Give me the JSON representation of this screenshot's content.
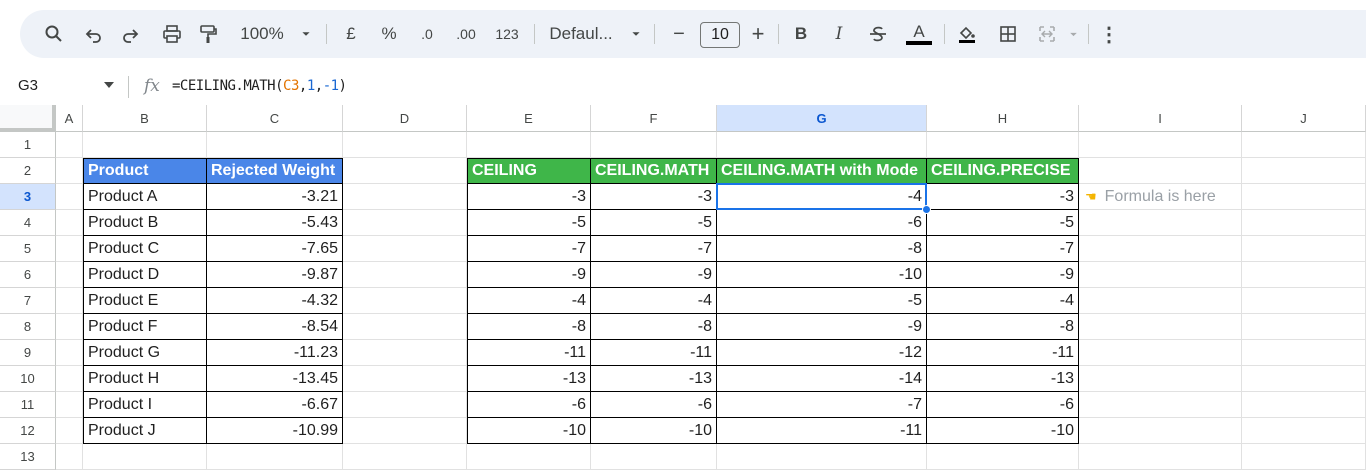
{
  "toolbar": {
    "zoom": "100%",
    "currency": "£",
    "percent": "%",
    "decrease_decimal": ".0",
    "increase_decimal": ".00",
    "number_format": "123",
    "font": "Defaul...",
    "minus": "−",
    "font_size": "10",
    "plus": "+",
    "bold": "B",
    "italic": "I",
    "text_color_letter": "A",
    "more": "⋮"
  },
  "formula_bar": {
    "name_box": "G3",
    "fx": "fx",
    "formula_prefix": "=CEILING.MATH(",
    "formula_ref": "C3",
    "formula_sep1": ",",
    "formula_arg1": "1",
    "formula_sep2": ",",
    "formula_arg2": "-1",
    "formula_suffix": ")"
  },
  "columns": [
    "A",
    "B",
    "C",
    "D",
    "E",
    "F",
    "G",
    "H",
    "I",
    "J"
  ],
  "selected_column": "G",
  "rows": [
    "1",
    "2",
    "3",
    "4",
    "5",
    "6",
    "7",
    "8",
    "9",
    "10",
    "11",
    "12",
    "13"
  ],
  "selected_row": "3",
  "left_table": {
    "headers": [
      "Product",
      "Rejected Weight"
    ],
    "rows": [
      [
        "Product A",
        "-3.21"
      ],
      [
        "Product B",
        "-5.43"
      ],
      [
        "Product C",
        "-7.65"
      ],
      [
        "Product D",
        "-9.87"
      ],
      [
        "Product E",
        "-4.32"
      ],
      [
        "Product F",
        "-8.54"
      ],
      [
        "Product G",
        "-11.23"
      ],
      [
        "Product H",
        "-13.45"
      ],
      [
        "Product I",
        "-6.67"
      ],
      [
        "Product J",
        "-10.99"
      ]
    ]
  },
  "right_table": {
    "headers": [
      "CEILING",
      "CEILING.MATH",
      "CEILING.MATH with Mode",
      "CEILING.PRECISE"
    ],
    "rows": [
      [
        "-3",
        "-3",
        "-4",
        "-3"
      ],
      [
        "-5",
        "-5",
        "-6",
        "-5"
      ],
      [
        "-7",
        "-7",
        "-8",
        "-7"
      ],
      [
        "-9",
        "-9",
        "-10",
        "-9"
      ],
      [
        "-4",
        "-4",
        "-5",
        "-4"
      ],
      [
        "-8",
        "-8",
        "-9",
        "-8"
      ],
      [
        "-11",
        "-11",
        "-12",
        "-11"
      ],
      [
        "-13",
        "-13",
        "-14",
        "-13"
      ],
      [
        "-6",
        "-6",
        "-7",
        "-6"
      ],
      [
        "-10",
        "-10",
        "-11",
        "-10"
      ]
    ]
  },
  "note": {
    "icon": "pointing-hand-icon",
    "text": "Formula is here"
  },
  "colors": {
    "blue_header": "#4a86e8",
    "green_header": "#3fb649",
    "selection": "#1a73e8"
  }
}
